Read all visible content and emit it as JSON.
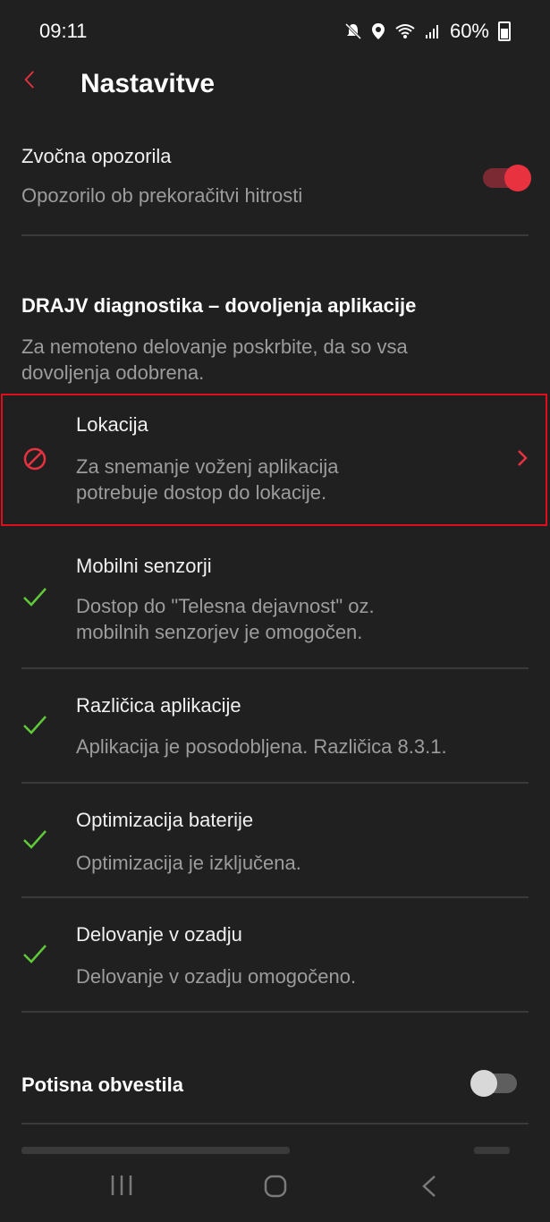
{
  "status_bar": {
    "time": "09:11",
    "battery": "60%"
  },
  "header": {
    "title": "Nastavitve"
  },
  "sound_alerts": {
    "label": "Zvočna opozorila",
    "sublabel": "Opozorilo ob prekoračitvi hitrosti",
    "enabled": true
  },
  "diagnostics": {
    "heading": "DRAJV diagnostika – dovoljenja aplikacije",
    "intro_line1": "Za nemoteno delovanje poskrbite, da so vsa",
    "intro_line2": "dovoljenja odobrena.",
    "items": [
      {
        "title": "Lokacija",
        "desc_line1": "Za snemanje voženj aplikacija",
        "desc_line2": "potrebuje dostop do lokacije.",
        "status": "blocked",
        "icon": "blocked-icon"
      },
      {
        "title": "Mobilni senzorji",
        "desc_line1": "Dostop do \"Telesna dejavnost\" oz.",
        "desc_line2": "mobilnih senzorjev je omogočen.",
        "status": "ok",
        "icon": "check-icon"
      },
      {
        "title": "Različica aplikacije",
        "desc_line1": "Aplikacija je posodobljena. Različica 8.3.1.",
        "desc_line2": "",
        "status": "ok",
        "icon": "check-icon"
      },
      {
        "title": "Optimizacija baterije",
        "desc_line1": "Optimizacija je izključena.",
        "desc_line2": "",
        "status": "ok",
        "icon": "check-icon"
      },
      {
        "title": "Delovanje v ozadju",
        "desc_line1": "Delovanje v ozadju omogočeno.",
        "desc_line2": "",
        "status": "ok",
        "icon": "check-icon"
      }
    ]
  },
  "push_notifications": {
    "label": "Potisna obvestila",
    "enabled": false
  },
  "colors": {
    "accent": "#e8323f",
    "ok": "#5fc93a",
    "background": "#202020",
    "highlight": "#e00d1a"
  }
}
